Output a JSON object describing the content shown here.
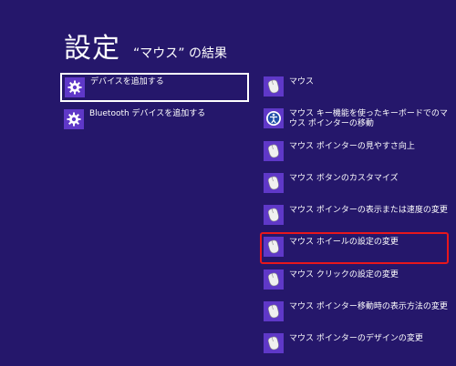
{
  "header": {
    "title": "設定",
    "subtitle": "“マウス” の結果"
  },
  "left_results": [
    {
      "label": "デバイスを追加する",
      "icon": "gear-icon"
    },
    {
      "label": "Bluetooth デバイスを追加する",
      "icon": "gear-icon"
    }
  ],
  "right_results": [
    {
      "label": "マウス",
      "icon": "mouse-icon"
    },
    {
      "label": "マウス キー機能を使ったキーボードでのマウス ポインターの移動",
      "icon": "ease-of-access-icon"
    },
    {
      "label": "マウス ポインターの見やすさ向上",
      "icon": "mouse-icon"
    },
    {
      "label": "マウス ボタンのカスタマイズ",
      "icon": "mouse-icon"
    },
    {
      "label": "マウス ポインターの表示または速度の変更",
      "icon": "mouse-icon"
    },
    {
      "label": "マウス ホイールの設定の変更",
      "icon": "mouse-icon"
    },
    {
      "label": "マウス クリックの設定の変更",
      "icon": "mouse-icon"
    },
    {
      "label": "マウス ポインター移動時の表示方法の変更",
      "icon": "mouse-icon"
    },
    {
      "label": "マウス ポインターのデザインの変更",
      "icon": "mouse-icon"
    }
  ],
  "colors": {
    "background": "#25176b",
    "icon_tile": "#5f38c8",
    "highlight": "#e8171c"
  }
}
